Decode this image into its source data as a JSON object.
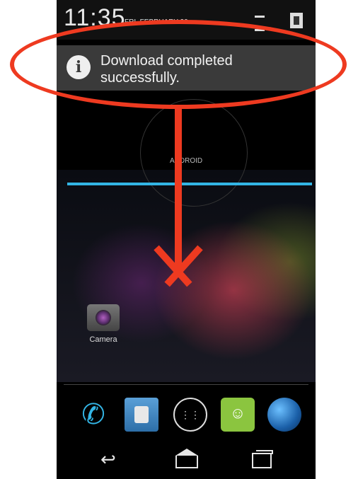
{
  "status_bar": {
    "time": "11:35",
    "date": "FRI, FEBRUARY 20"
  },
  "notification": {
    "icon": "info-icon",
    "message": "Download completed successfully."
  },
  "widget": {
    "label": "ANDROID"
  },
  "home_screen": {
    "camera_label": "Camera"
  },
  "dock": {
    "apps": [
      "phone-icon",
      "contacts-icon",
      "app-drawer-icon",
      "messaging-icon",
      "browser-icon"
    ]
  },
  "navigation": {
    "buttons": [
      "back",
      "home",
      "recents"
    ]
  },
  "annotation": {
    "color": "#ee3a20"
  }
}
